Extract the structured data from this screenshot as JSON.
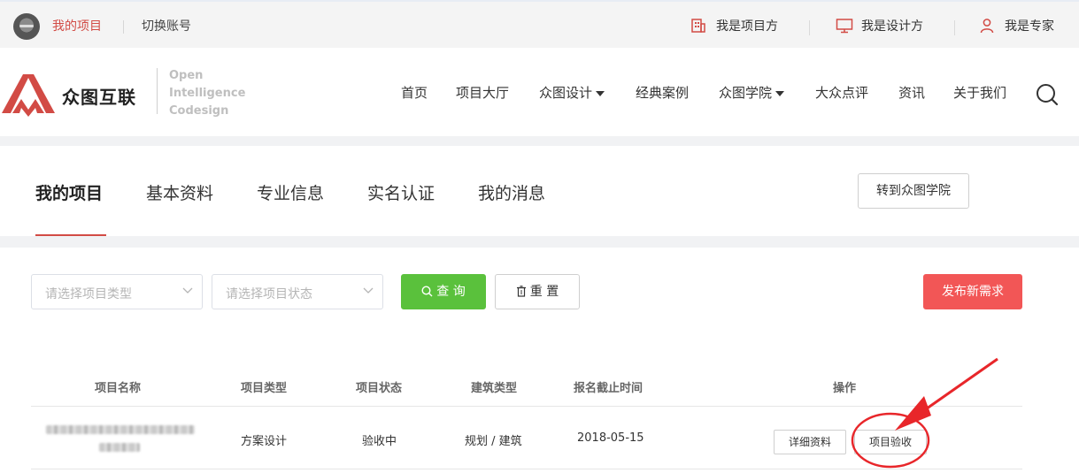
{
  "topbar": {
    "my_projects": "我的项目",
    "switch_account": "切换账号",
    "roles": [
      "我是项目方",
      "我是设计方",
      "我是专家"
    ]
  },
  "brand": {
    "name": "众图互联",
    "tagline": [
      "Open",
      "Intelligence",
      "Codesign"
    ],
    "color_red": "#d24b45"
  },
  "nav": [
    "首页",
    "项目大厅",
    "众图设计",
    "经典案例",
    "众图学院",
    "大众点评",
    "资讯",
    "关于我们"
  ],
  "tabs": [
    "我的项目",
    "基本资料",
    "专业信息",
    "实名认证",
    "我的消息"
  ],
  "academy_button": "转到众图学院",
  "filters": {
    "type_placeholder": "请选择项目类型",
    "status_placeholder": "请选择项目状态",
    "search_label": "查 询",
    "reset_label": "重 置",
    "publish_label": "发布新需求"
  },
  "table": {
    "headers": [
      "项目名称",
      "项目类型",
      "项目状态",
      "建筑类型",
      "报名截止时间",
      "操作"
    ],
    "rows": [
      {
        "type": "方案设计",
        "status": "验收中",
        "building_type": "规划 / 建筑",
        "deadline": "2018-05-15",
        "actions": [
          "详细资料",
          "项目验收"
        ]
      }
    ]
  },
  "colors": {
    "search_btn": "#5ac13c",
    "publish_btn": "#f25656",
    "annotation": "#e8262a"
  }
}
